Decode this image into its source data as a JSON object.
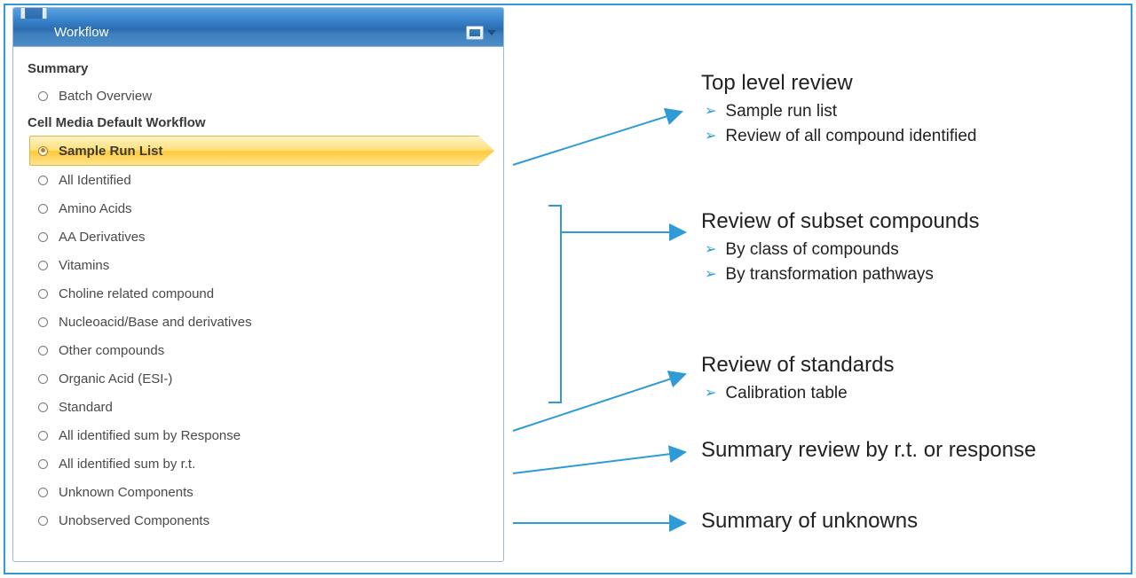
{
  "panel": {
    "title": "Workflow",
    "sections": {
      "summary_header": "Summary",
      "batch_overview": "Batch Overview",
      "workflow_header": "Cell Media Default Workflow",
      "items": [
        "Sample Run List",
        "All Identified",
        "Amino Acids",
        "AA Derivatives",
        "Vitamins",
        "Choline related compound",
        "Nucleoacid/Base and derivatives",
        "Other compounds",
        "Organic Acid (ESI-)",
        "Standard",
        "All identified sum by Response",
        "All identified sum by r.t.",
        "Unknown Components",
        "Unobserved Components"
      ]
    }
  },
  "annotations": {
    "a1": {
      "title": "Top level review",
      "bullets": [
        "Sample run list",
        "Review of all compound identified"
      ]
    },
    "a2": {
      "title": "Review of subset compounds",
      "bullets": [
        "By class of compounds",
        "By transformation pathways"
      ]
    },
    "a3": {
      "title": "Review of standards",
      "bullets": [
        "Calibration table"
      ]
    },
    "a4": {
      "title": "Summary review by r.t. or response"
    },
    "a5": {
      "title": "Summary of unknowns"
    }
  }
}
